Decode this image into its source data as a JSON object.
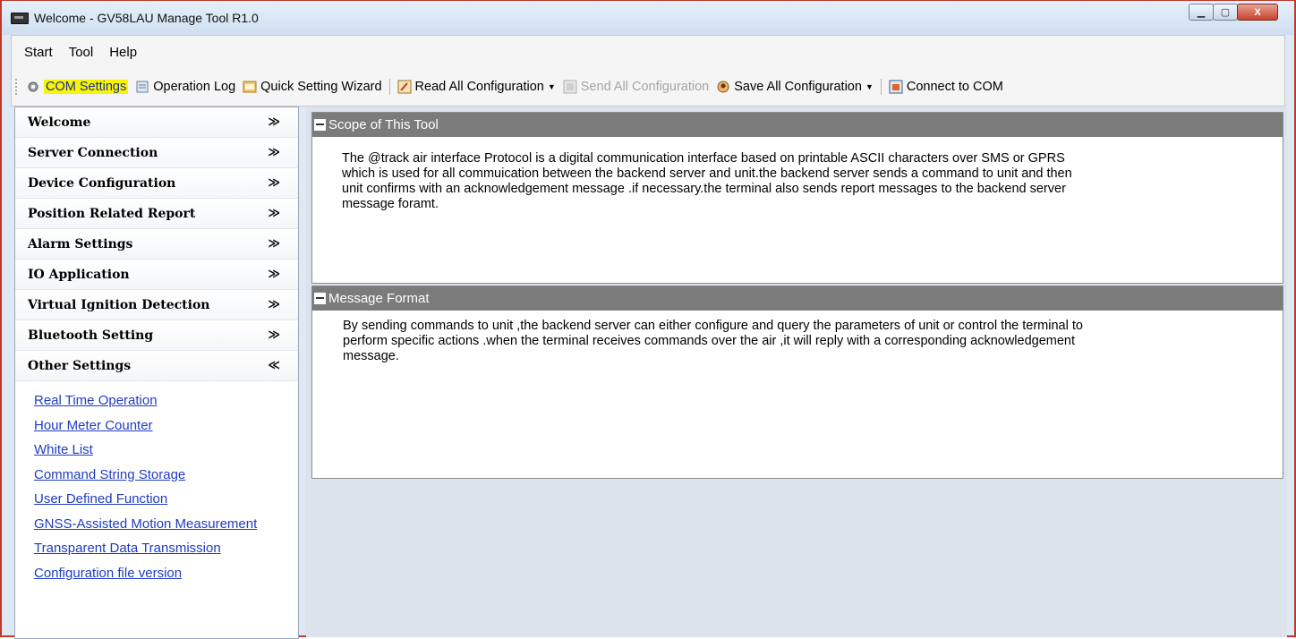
{
  "window": {
    "title": "Welcome - GV58LAU Manage Tool R1.0",
    "buttons": [
      "▁",
      "▢",
      "X"
    ]
  },
  "menu": [
    "Start",
    "Tool",
    "Help"
  ],
  "toolbar": {
    "com_settings": "COM Settings",
    "operation_log": "Operation Log",
    "quick_setting": "Quick Setting Wizard",
    "read_all": "Read All Configuration",
    "send_all": "Send All Configuration",
    "save_all": "Save All Configuration",
    "connect_com": "Connect to COM"
  },
  "sidebar": {
    "items": [
      {
        "label": "Welcome",
        "chevron": "≫"
      },
      {
        "label": "Server Connection",
        "chevron": "≫"
      },
      {
        "label": "Device Configuration",
        "chevron": "≫"
      },
      {
        "label": "Position Related Report",
        "chevron": "≫"
      },
      {
        "label": "Alarm Settings",
        "chevron": "≫"
      },
      {
        "label": "IO Application",
        "chevron": "≫"
      },
      {
        "label": "Virtual Ignition Detection",
        "chevron": "≫"
      },
      {
        "label": "Bluetooth Setting",
        "chevron": "≫"
      },
      {
        "label": "Other Settings",
        "chevron": "≪"
      }
    ],
    "sub_links": [
      "Real Time Operation",
      "Hour Meter Counter",
      "White List",
      "Command String Storage",
      "User Defined Function",
      "GNSS-Assisted Motion Measurement",
      "Transparent Data Transmission",
      "Configuration file version"
    ]
  },
  "panels": {
    "scope": {
      "title": "Scope of This Tool",
      "body": "The @track air interface Protocol is a digital communication interface based on printable ASCII characters over SMS or GPRS which is used for all commuication between the backend server and unit.the backend server sends a command to unit and then unit confirms with an acknowledgement message .if necessary.the terminal also sends report messages to the backend server message foramt."
    },
    "format": {
      "title": "Message Format",
      "body": "By sending commands to unit ,the backend server can either configure and query the parameters of unit or control the terminal to perform specific actions .when the terminal receives commands over the air ,it will reply with a corresponding acknowledgement message."
    }
  },
  "colors": {
    "highlight": "#f7f500",
    "link": "#1f3cc2",
    "panel_header": "#7b7b7b"
  }
}
